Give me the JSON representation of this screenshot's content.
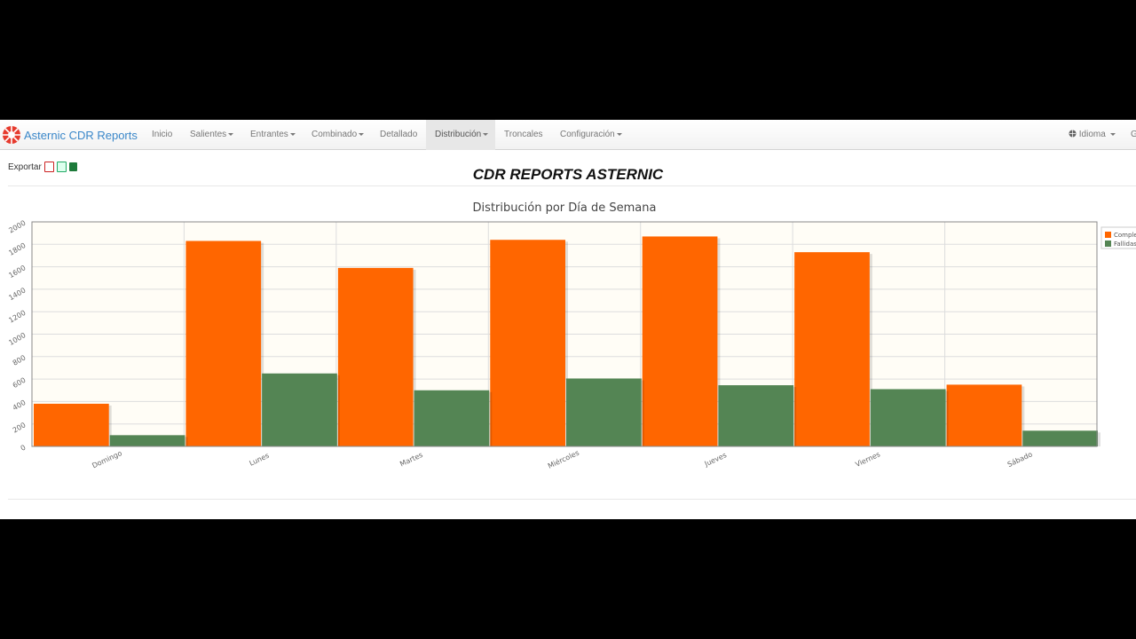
{
  "nav": {
    "brand": "Asternic CDR Reports",
    "items": [
      {
        "label": "Inicio",
        "caret": false
      },
      {
        "label": "Salientes",
        "caret": true
      },
      {
        "label": "Entrantes",
        "caret": true
      },
      {
        "label": "Combinado",
        "caret": true
      },
      {
        "label": "Detallado",
        "caret": false
      },
      {
        "label": "Distribución",
        "caret": true,
        "active": true
      },
      {
        "label": "Troncales",
        "caret": false
      },
      {
        "label": "Configuración",
        "caret": true
      }
    ],
    "language": "Idioma",
    "right_cut": "G"
  },
  "export": {
    "label": "Exportar",
    "icons": [
      "pdf-icon",
      "csv-icon",
      "excel-icon"
    ]
  },
  "page_title": "CDR REPORTS ASTERNIC",
  "colors": {
    "completed": "#ff6600",
    "failed": "#548554",
    "plot_bg": "#fffdf6",
    "brand": "#3a87c9"
  },
  "chart_data": {
    "type": "bar",
    "title": "Distribución por Día de Semana",
    "categories": [
      "Domingo",
      "Lunes",
      "Martes",
      "Miércoles",
      "Jueves",
      "Viernes",
      "Sábado"
    ],
    "series": [
      {
        "name": "Comple",
        "values": [
          380,
          1830,
          1590,
          1840,
          1870,
          1730,
          550
        ]
      },
      {
        "name": "Fallidas",
        "values": [
          100,
          650,
          500,
          605,
          545,
          510,
          140
        ]
      }
    ],
    "yticks": [
      0,
      200,
      400,
      600,
      800,
      1000,
      1200,
      1400,
      1600,
      1800,
      2000
    ],
    "ylim": [
      0,
      2000
    ],
    "grid": true,
    "legend": "right"
  }
}
